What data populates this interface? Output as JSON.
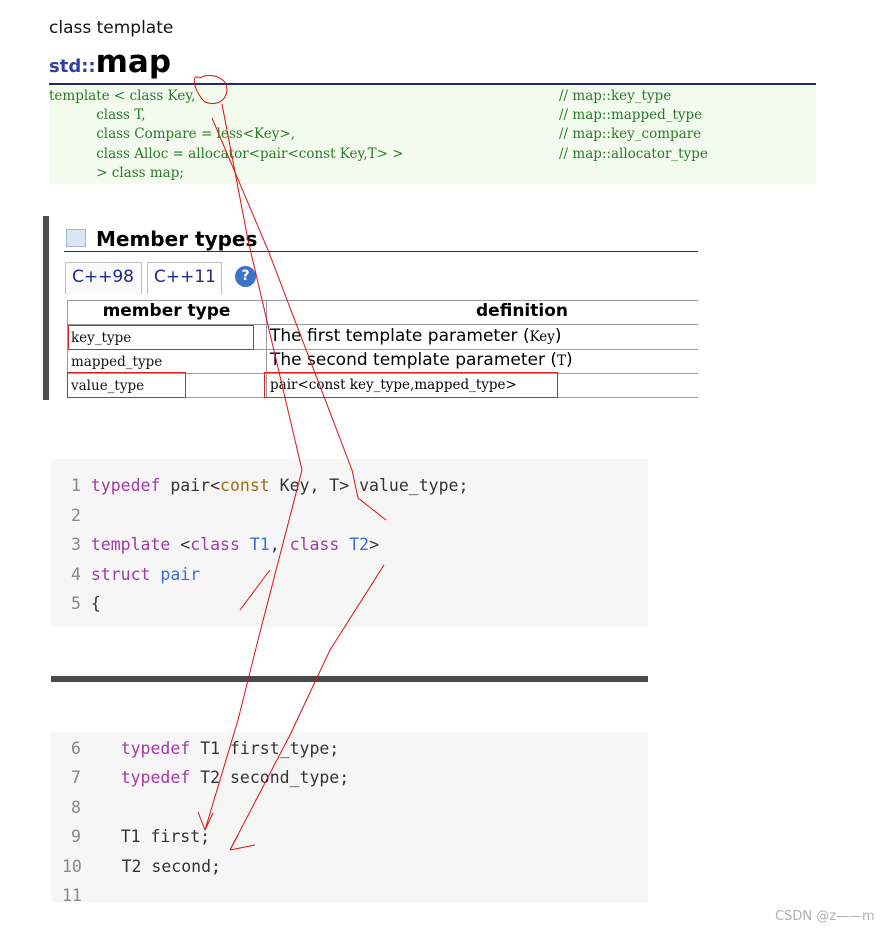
{
  "header": {
    "eyebrow": "class template",
    "namespace": "std::",
    "name": "map"
  },
  "declaration": {
    "lines": [
      {
        "code": "template < class Key,",
        "comment": "// map::key_type"
      },
      {
        "code": "           class T,",
        "comment": "// map::mapped_type"
      },
      {
        "code": "           class Compare = less<Key>,",
        "comment": "// map::key_compare"
      },
      {
        "code": "           class Alloc = allocator<pair<const Key,T> >",
        "comment": "// map::allocator_type"
      },
      {
        "code": "           > class map;",
        "comment": ""
      }
    ]
  },
  "member_types": {
    "title": "Member types",
    "tabs": [
      "C++98",
      "C++11"
    ],
    "active_tab": "C++11",
    "help_icon": "?",
    "columns": [
      "member type",
      "definition"
    ],
    "rows": [
      {
        "type": "key_type",
        "def_prefix": "The first template parameter (",
        "def_code": "Key",
        "def_suffix": ")"
      },
      {
        "type": "mapped_type",
        "def_prefix": "The second template parameter (",
        "def_code": "T",
        "def_suffix": ")"
      },
      {
        "type": "value_type",
        "def_prefix": "",
        "def_code": "pair<const key_type,mapped_type>",
        "def_suffix": ""
      }
    ]
  },
  "code_block_1": {
    "line_numbers": [
      "1",
      "2",
      "3",
      "4",
      "5"
    ],
    "line1": {
      "kw": "typedef",
      "plain1": " pair<",
      "kw2": "const",
      "plain2": " Key, T> value_type;"
    },
    "line3": {
      "kw": "template",
      "plain1": " <",
      "kw2": "class",
      "ty1": " T1",
      "plain2": ", ",
      "kw3": "class",
      "ty2": " T2",
      "plain3": ">"
    },
    "line4": {
      "kw": "struct",
      "ty": " pair"
    },
    "line5": {
      "brace": "{"
    }
  },
  "code_block_2": {
    "line_numbers": [
      "6",
      "7",
      "8",
      "9",
      "10",
      "11"
    ],
    "line6": {
      "kw": "typedef",
      "plain": " T1 first_type;"
    },
    "line7": {
      "kw": "typedef",
      "plain": " T2 second_type;"
    },
    "line9": {
      "plain": "T1 first;"
    },
    "line10": {
      "plain": "T2 second;"
    }
  },
  "watermark": "CSDN @z——m",
  "colors": {
    "annotation_red": "#dd1111",
    "keyword": "#a23aa8",
    "type": "#3b6fd4",
    "declaration_green": "#2a7a2a",
    "heading_blue": "#2f3e9f"
  }
}
